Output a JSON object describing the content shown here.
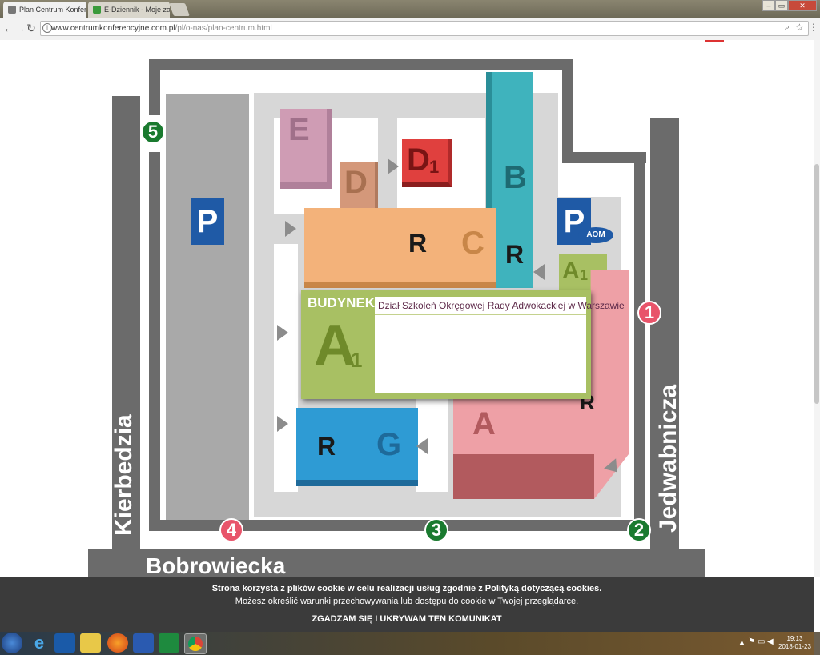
{
  "browser": {
    "tabs": [
      {
        "label": "Plan Centrum Konferenc",
        "active": true
      },
      {
        "label": "E-Dziennik - Moje zajęci",
        "active": false
      }
    ],
    "url_host": "www.centrumkonferencyjne.com.pl",
    "url_path": "/pl/o-nas/plan-centrum.html",
    "window_buttons": [
      "–",
      "▭",
      "✕"
    ]
  },
  "map": {
    "streets": {
      "west": "Kierbedzia",
      "south": "Bobrowiecka",
      "east": "Jedwabnicza"
    },
    "gates": {
      "g1": "1",
      "g2": "2",
      "g3": "3",
      "g4": "4",
      "g5": "5"
    },
    "parking": {
      "p1": "P",
      "p2": "P"
    },
    "logo": "AOM",
    "buildings": {
      "E": "E",
      "D": "D",
      "D1": "D",
      "D1sub": "1",
      "B": "B",
      "C": "C",
      "R1": "R",
      "R2": "R",
      "R3": "R",
      "R4": "R",
      "G": "G",
      "A": "A",
      "A1small": "A",
      "A1smallsub": "1"
    }
  },
  "popup": {
    "label": "BUDYNEK",
    "letter": "A",
    "sub": "1",
    "title": "Dział Szkoleń Okręgowej Rady Adwokackiej w Warszawie"
  },
  "cookie": {
    "line1": "Strona korzysta z plików cookie w celu realizacji usług zgodnie z Polityką dotyczącą cookies.",
    "line2": "Możesz określić warunki przechowywania lub dostępu do cookie w Twojej przeglądarce.",
    "accept": "ZGADZAM SIĘ I UKRYWAM TEN KOMUNIKAT"
  },
  "taskbar": {
    "time": "19:13",
    "date": "2018-01-23"
  },
  "colors": {
    "road": "#6b6b6b",
    "gate_green": "#1a7a2f",
    "gate_red": "#e8546a",
    "building_A": "#eea0a6",
    "building_B": "#3fb3bd",
    "building_C": "#f3b27a",
    "building_D": "#d4987a",
    "building_D1": "#e0403e",
    "building_E": "#cf9cb4",
    "building_G": "#2e9bd4",
    "building_A1": "#a8c063",
    "parking_sign": "#1f5aa6"
  }
}
